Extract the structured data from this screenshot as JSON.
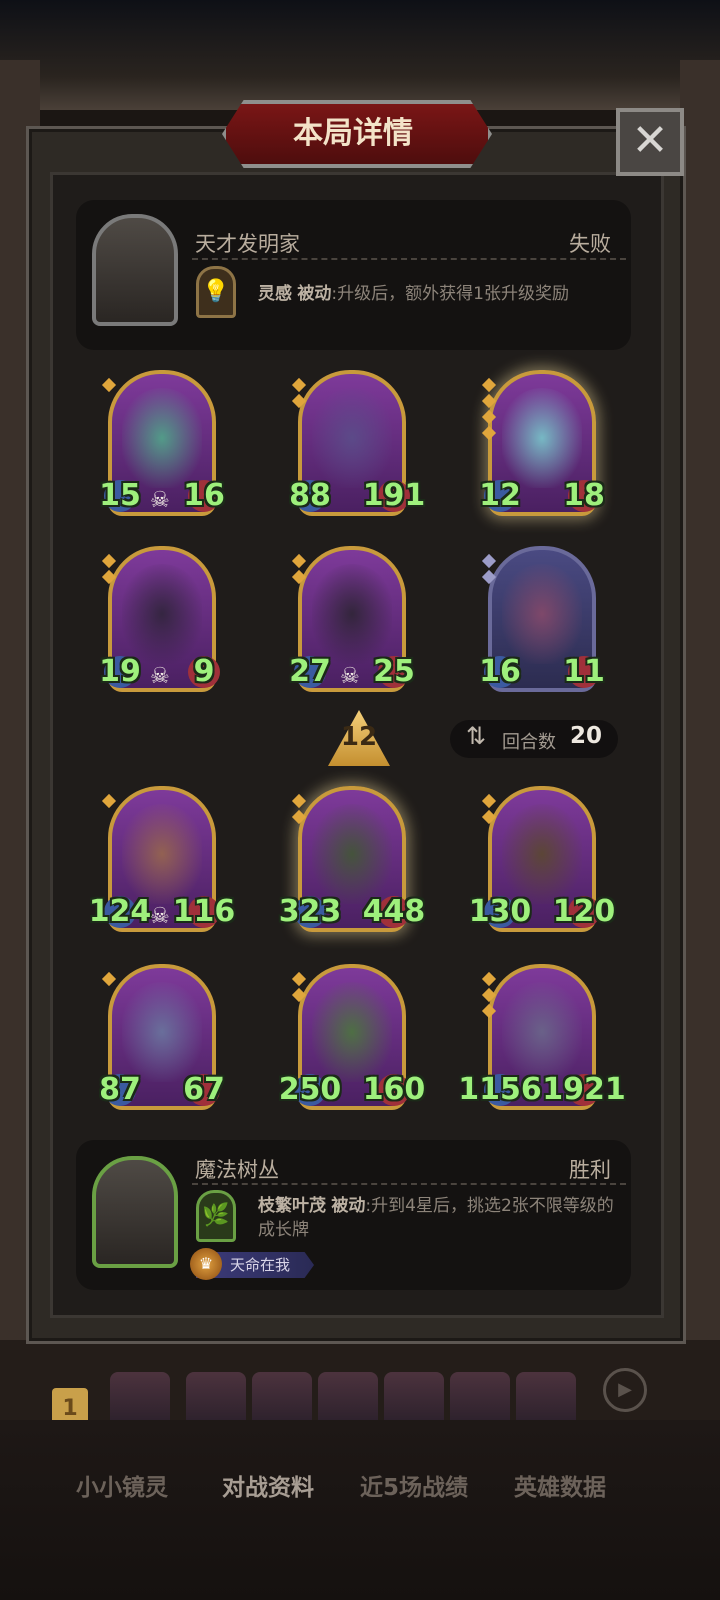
{
  "title": "本局详情",
  "close_icon": "close-icon",
  "player1": {
    "name": "天才发明家",
    "result": "失败",
    "skill_name": "灵感",
    "skill_type": "被动",
    "skill_desc": ":升级后，额外获得1张升级奖励",
    "skill_icon": "lightbulb-icon"
  },
  "player2": {
    "name": "魔法树丛",
    "result": "胜利",
    "skill_name": "枝繁叶茂",
    "skill_type": "被动",
    "skill_desc": ":升到4星后，挑选2张不限等级的成长牌",
    "fate_badge": "天命在我"
  },
  "tier": "12",
  "rounds": {
    "label": "回合数",
    "value": "20"
  },
  "top_cards": [
    {
      "attack": "15",
      "health": "16",
      "dead": true,
      "pips": 1,
      "frame": "gold"
    },
    {
      "attack": "88",
      "health": "191",
      "dead": false,
      "pips": 2,
      "frame": "gold"
    },
    {
      "attack": "12",
      "health": "18",
      "dead": false,
      "pips": 4,
      "frame": "gold",
      "glow": true
    },
    {
      "attack": "19",
      "health": "9",
      "dead": true,
      "pips": 2,
      "frame": "gold"
    },
    {
      "attack": "27",
      "health": "25",
      "dead": true,
      "pips": 2,
      "frame": "gold"
    },
    {
      "attack": "16",
      "health": "11",
      "dead": false,
      "pips": 2,
      "frame": "blue"
    }
  ],
  "bottom_cards": [
    {
      "attack": "124",
      "health": "116",
      "dead": true,
      "pips": 1,
      "frame": "gold"
    },
    {
      "attack": "323",
      "health": "448",
      "dead": false,
      "pips": 2,
      "frame": "gold",
      "glow": true
    },
    {
      "attack": "130",
      "health": "120",
      "dead": false,
      "pips": 2,
      "frame": "gold"
    },
    {
      "attack": "87",
      "health": "67",
      "dead": false,
      "pips": 1,
      "frame": "gold"
    },
    {
      "attack": "250",
      "health": "160",
      "dead": false,
      "pips": 2,
      "frame": "gold"
    },
    {
      "attack": "1156",
      "health": "1921",
      "dead": false,
      "pips": 3,
      "frame": "gold"
    }
  ],
  "tabs": [
    "小小镜灵",
    "对战资料",
    "近5场战绩",
    "英雄数据"
  ],
  "strip_badge": "1",
  "colors": {
    "accent_gold": "#c89a3c",
    "stat_green": "#9ef07c",
    "title_red": "#7a1616"
  }
}
